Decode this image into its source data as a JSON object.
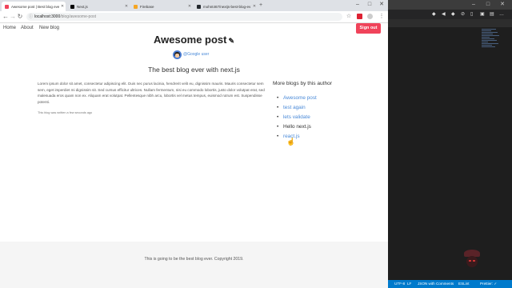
{
  "browser": {
    "tabs": [
      {
        "title": "Awesome post | Best blog ever wi…",
        "favicon_color": "#f0435a",
        "active": true
      },
      {
        "title": "Next.js",
        "favicon_color": "#000000",
        "active": false
      },
      {
        "title": "Firebase",
        "favicon_color": "#f5a623",
        "active": false
      },
      {
        "title": "mohnt467/nextjs-best-blog-ev…",
        "favicon_color": "#24292e",
        "active": false
      }
    ],
    "new_tab": "+",
    "url_host": "localhost:3000",
    "url_path": "/blog/awesome-post"
  },
  "page": {
    "nav": {
      "home": "Home",
      "about": "About",
      "new_blog": "New blog",
      "sign_out": "Sign out"
    },
    "title": "Awesome post",
    "author": "@Google user",
    "subtitle": "The best blog ever with next.js",
    "content": "Lorem ipsum dolor sit amet, consectetur adipiscing elit. Duis nec purus lacinia, hendrerit velit eu, dignissim mauris. Mauris consectetur sem sem, eget imperdiet mi dignissim sit. Sed cursus efficitur ultrices. Nullam fermentum, nisi eu commodo lobortis, justo dolor volutpat erat, sed malesuada eros quam non ex. Aliquam erat volutpat. Pellentesque nibh arcu, lobortis vel metus tempus, euismod rutrum est. Suspendisse potenti.",
    "written": "This blog was written a few seconds ago",
    "more_heading": "More blogs by this author",
    "more_blogs": [
      "Awesome post",
      "test again",
      "lets validate",
      "Hello next.js",
      "react.js"
    ],
    "footer": "This is going to be the best blog ever. Copyright 2019."
  },
  "vscode": {
    "status": {
      "encoding": "UTF-8",
      "eol": "LF",
      "language": "JSON with Comments",
      "lint": "ESLint",
      "formatter": "Prettier: ✓"
    }
  },
  "colors": {
    "accent": "#f0435a",
    "link": "#4a8ad8",
    "vscode_status": "#007acc"
  }
}
